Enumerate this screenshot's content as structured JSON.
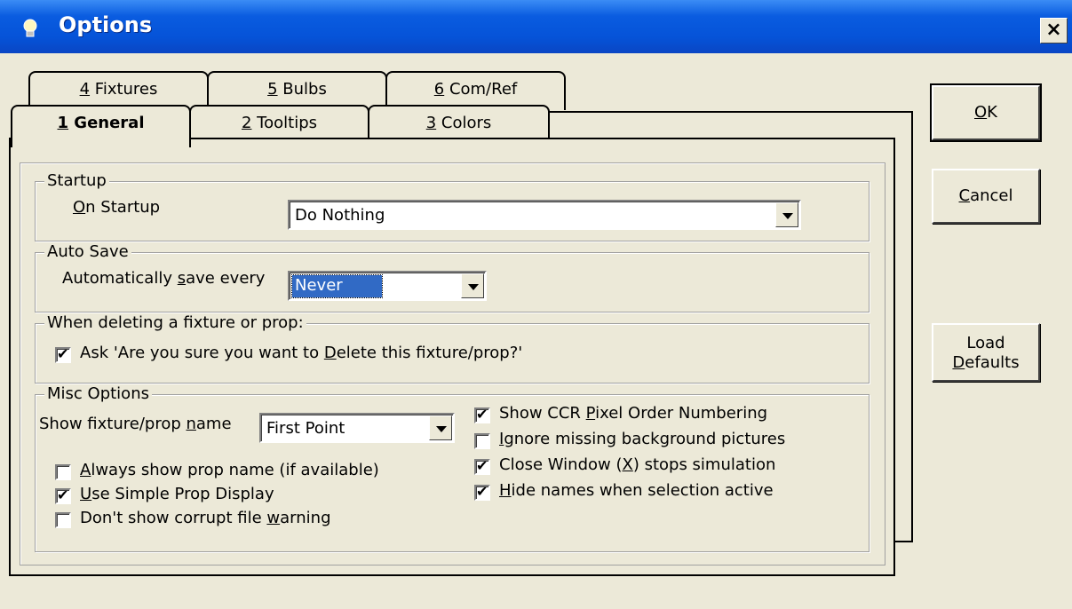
{
  "window": {
    "title": "Options",
    "close_label": "×"
  },
  "tabs": {
    "t4": {
      "num": "4",
      "label": " Fixtures"
    },
    "t5": {
      "num": "5",
      "label": " Bulbs"
    },
    "t6": {
      "num": "6",
      "label": " Com/Ref"
    },
    "t1": {
      "num": "1",
      "label": " General"
    },
    "t2": {
      "num": "2",
      "label": " Tooltips"
    },
    "t3": {
      "num": "3",
      "label": " Colors"
    }
  },
  "startup": {
    "group_label": "Startup",
    "on_startup_u": "O",
    "on_startup_rest": "n Startup",
    "value": "Do Nothing"
  },
  "autosave": {
    "group_label": "Auto Save",
    "label_pre": "Automatically ",
    "label_u": "s",
    "label_post": "ave every",
    "value": "Never"
  },
  "delete": {
    "group_label": "When deleting a fixture or prop:",
    "ask_pre": "Ask 'Are you sure you want to ",
    "ask_u": "D",
    "ask_post": "elete this fixture/prop?'",
    "checked": true
  },
  "misc": {
    "group_label": "Misc Options",
    "show_name_pre": "Show fixture/prop ",
    "show_name_u": "n",
    "show_name_post": "ame",
    "show_name_value": "First Point",
    "always_u": "A",
    "always_rest": "lways show prop name (if available)",
    "simple_u": "U",
    "simple_rest": "se Simple Prop Display",
    "corrupt_pre": "Don't show corrupt file ",
    "corrupt_u": "w",
    "corrupt_post": "arning",
    "ccr_pre": "Show CCR ",
    "ccr_u": "P",
    "ccr_post": "ixel Order Numbering",
    "ignore_u": "I",
    "ignore_rest": "gnore missing background pictures",
    "close_pre": "Close Window (",
    "close_u": "X",
    "close_post": ") stops simulation",
    "hide_u": "H",
    "hide_rest": "ide names when selection active"
  },
  "buttons": {
    "ok_u": "O",
    "ok_rest": "K",
    "cancel_u": "C",
    "cancel_rest": "ancel",
    "load_line1": "Load",
    "load_u": "D",
    "load_rest": "efaults"
  }
}
